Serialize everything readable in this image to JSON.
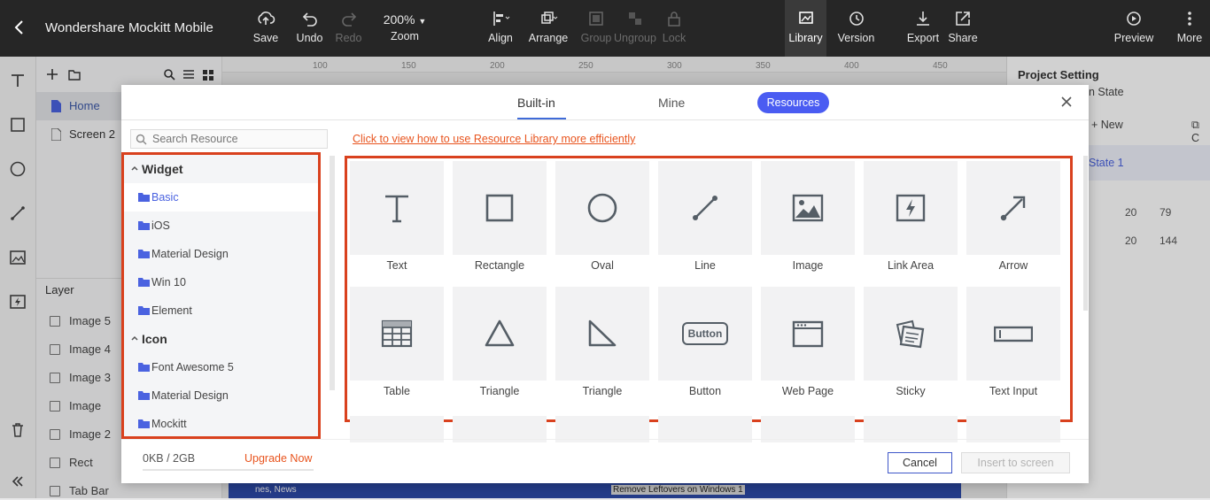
{
  "app": {
    "title": "Wondershare Mockitt Mobile"
  },
  "toolbar": {
    "save": "Save",
    "undo": "Undo",
    "redo": "Redo",
    "zoom_value": "200%",
    "zoom": "Zoom",
    "align": "Align",
    "arrange": "Arrange",
    "group": "Group",
    "ungroup": "Ungroup",
    "lock": "Lock",
    "library": "Library",
    "version": "Version",
    "export": "Export",
    "share": "Share",
    "preview": "Preview",
    "more": "More"
  },
  "pages": {
    "items": [
      {
        "label": "Home"
      },
      {
        "label": "Screen 2"
      }
    ]
  },
  "layers": {
    "title": "Layer",
    "items": [
      {
        "label": "Image 5"
      },
      {
        "label": "Image 4"
      },
      {
        "label": "Image 3"
      },
      {
        "label": "Image"
      },
      {
        "label": "Image 2"
      },
      {
        "label": "Rect"
      },
      {
        "label": "Tab Bar"
      }
    ]
  },
  "ruler": {
    "ticks": [
      "100",
      "150",
      "200",
      "250",
      "300",
      "350",
      "400",
      "450"
    ]
  },
  "right_panel": {
    "title": "Project Setting",
    "state": "n State",
    "new": "New",
    "c": "C",
    "state1": "State 1",
    "row1": [
      "20",
      "79"
    ],
    "row2": [
      "20",
      "144"
    ]
  },
  "modal": {
    "tabs": {
      "builtin": "Built-in",
      "mine": "Mine",
      "resources": "Resources"
    },
    "search_placeholder": "Search Resource",
    "hint": "Click to view how to use Resource Library more efficiently",
    "tree": {
      "widget": "Widget",
      "widget_items": [
        {
          "label": "Basic"
        },
        {
          "label": "iOS"
        },
        {
          "label": "Material Design"
        },
        {
          "label": "Win 10"
        },
        {
          "label": "Element"
        }
      ],
      "icon": "Icon",
      "icon_items": [
        {
          "label": "Font Awesome 5"
        },
        {
          "label": "Material Design"
        },
        {
          "label": "Mockitt"
        }
      ]
    },
    "widgets": [
      {
        "label": "Text",
        "icon": "text-icon"
      },
      {
        "label": "Rectangle",
        "icon": "rectangle-icon"
      },
      {
        "label": "Oval",
        "icon": "oval-icon"
      },
      {
        "label": "Line",
        "icon": "line-icon"
      },
      {
        "label": "Image",
        "icon": "image-icon"
      },
      {
        "label": "Link Area",
        "icon": "link-area-icon"
      },
      {
        "label": "Arrow",
        "icon": "arrow-icon"
      },
      {
        "label": "Table",
        "icon": "table-icon"
      },
      {
        "label": "Triangle",
        "icon": "triangle-icon"
      },
      {
        "label": "Triangle",
        "icon": "right-triangle-icon"
      },
      {
        "label": "Button",
        "icon": "button-icon",
        "icon_text": "Button"
      },
      {
        "label": "Web Page",
        "icon": "web-page-icon"
      },
      {
        "label": "Sticky",
        "icon": "sticky-icon"
      },
      {
        "label": "Text Input",
        "icon": "text-input-icon"
      }
    ],
    "quota": "0KB / 2GB",
    "upgrade": "Upgrade Now",
    "cancel": "Cancel",
    "insert": "Insert to screen"
  },
  "canvas_strip": {
    "left": "nes, News",
    "right": "Remove Leftovers on Windows 1"
  },
  "colors": {
    "accent": "#4a5cf2",
    "highlight_border": "#d9411e",
    "link": "#e8541e",
    "topbar": "#262626"
  }
}
